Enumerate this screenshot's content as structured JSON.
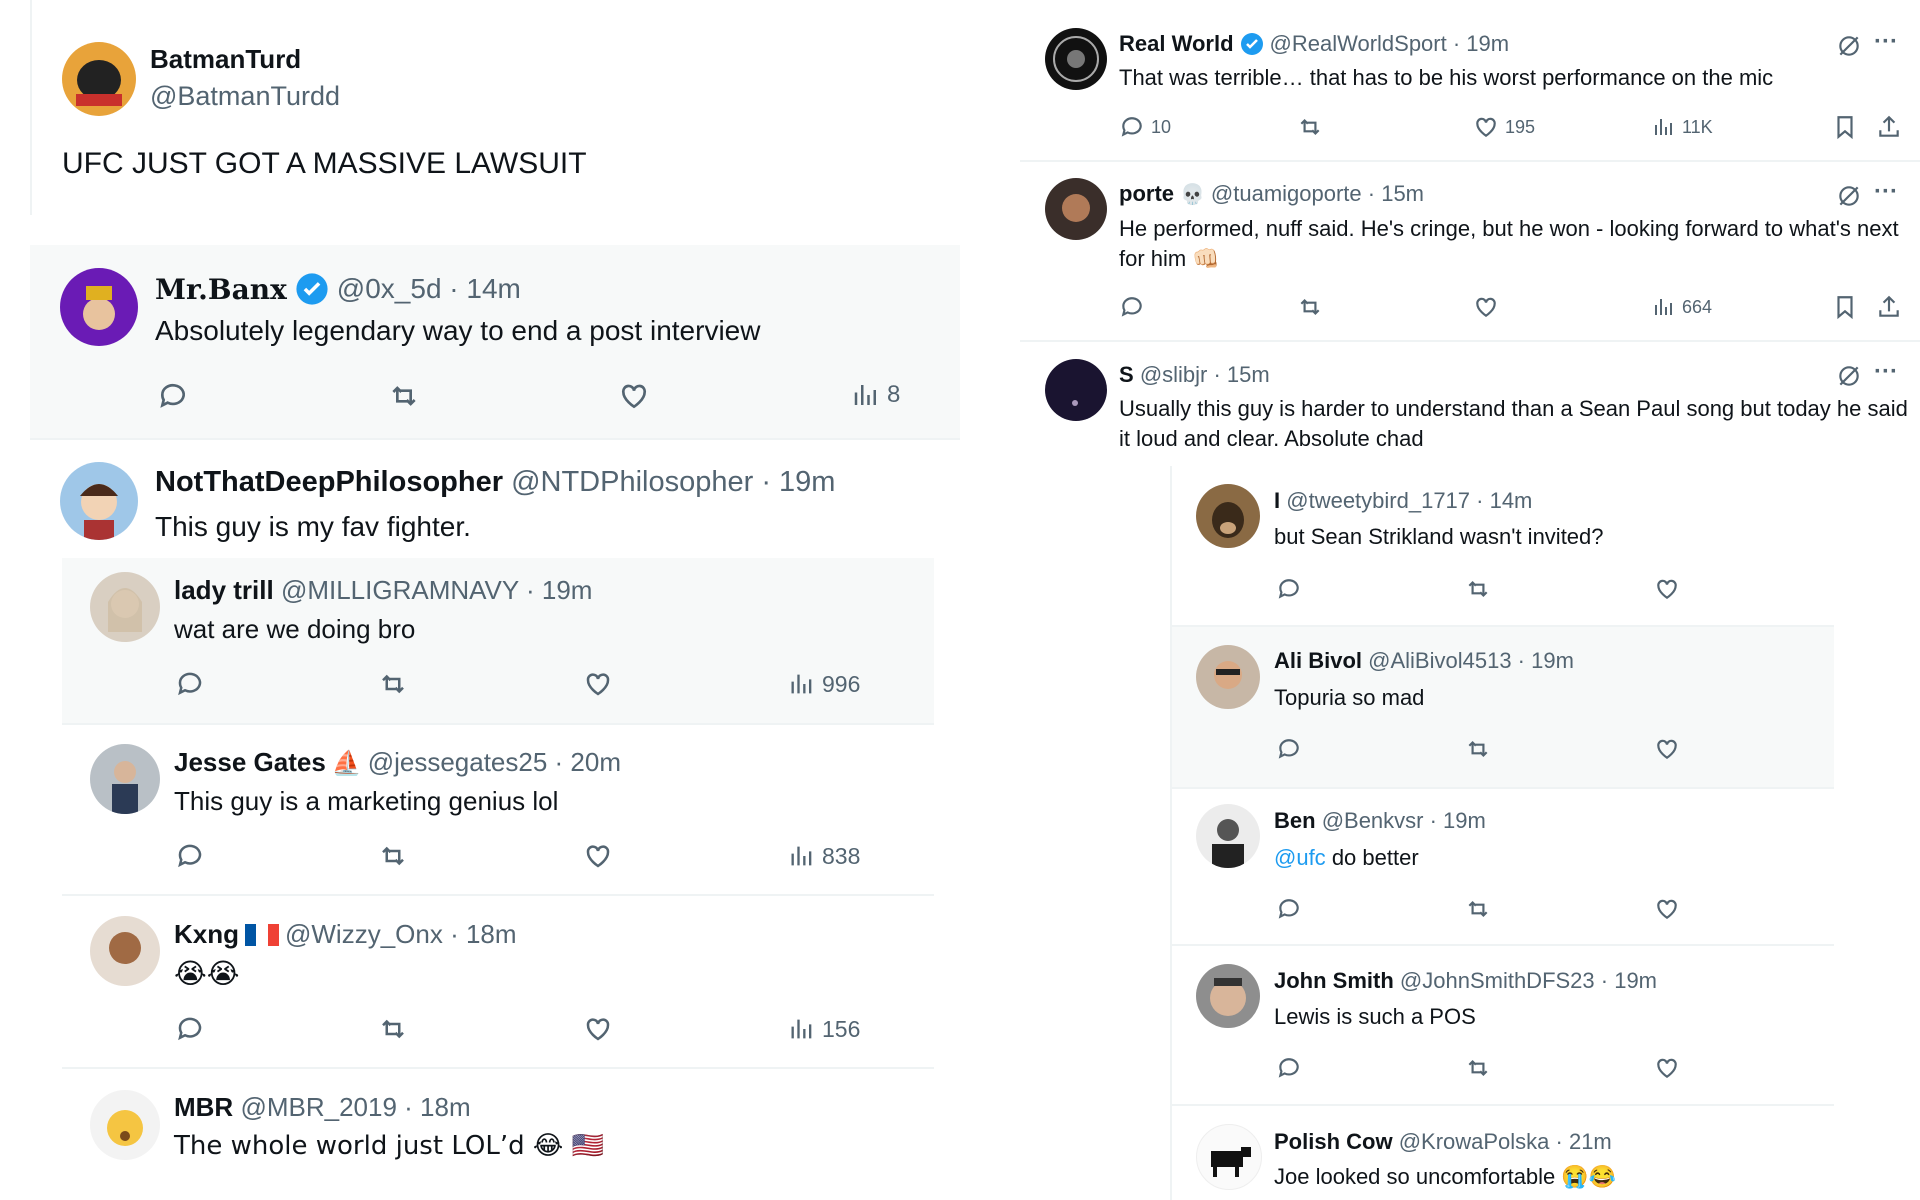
{
  "colors": {
    "text": "#0f1419",
    "muted": "#536471",
    "link": "#1d9bf0",
    "verified": "#1d9bf0",
    "border": "#eff3f4",
    "tint": "#f7f9f9"
  },
  "left": {
    "main": {
      "name": "BatmanTurd",
      "handle": "@BatmanTurdd",
      "text": "UFC JUST GOT A MASSIVE LAWSUIT"
    },
    "t1": {
      "name": "Mr.Banx",
      "handle": "@0x_5d · 14m",
      "text": "Absolutely legendary way to end a post interview",
      "views": "8"
    },
    "t2": {
      "name": "NotThatDeepPhilosopher",
      "handle": "@NTDPhilosopher · 19m",
      "text": "This guy is my fav fighter."
    },
    "r1": {
      "name": "lady trill",
      "handle": "@MILLIGRAMNAVY · 19m",
      "text": "wat are we doing bro",
      "views": "996"
    },
    "r2": {
      "name": "Jesse Gates",
      "handle": "@jessegates25 · 20m",
      "text": "This guy is a marketing genius lol",
      "views": "838"
    },
    "r3": {
      "name": "Kxng",
      "handle": "@Wizzy_Onx · 18m",
      "text": "😭😭",
      "views": "156"
    },
    "r4": {
      "name": "MBR",
      "handle": "@MBR_2019 · 18m",
      "text": "The whole world just LOL’d 😂 🇺🇸"
    }
  },
  "right": {
    "t1": {
      "name": "Real World",
      "handle": "@RealWorldSport · 19m",
      "text": "That was terrible… that has to be his worst performance on the mic",
      "replies": "10",
      "likes": "195",
      "views": "11K"
    },
    "t2": {
      "name": "porte",
      "handle": "@tuamigoporte · 15m",
      "text": "He performed, nuff said. He's cringe, but he won - looking forward to what's next for him 👊🏻",
      "views": "664"
    },
    "t3": {
      "name": "S",
      "handle": "@slibjr · 15m",
      "text": "Usually this guy is harder to understand than a Sean Paul song but today he said it loud and clear. Absolute chad"
    },
    "n1": {
      "name": "I",
      "handle": "@tweetybird_1717 · 14m",
      "text": "but Sean Strikland wasn't invited?"
    },
    "n2": {
      "name": "Ali Bivol",
      "handle": "@AliBivol4513 · 19m",
      "text": "Topuria so mad"
    },
    "n3": {
      "name": "Ben",
      "handle": "@Benkvsr · 19m",
      "mention": "@ufc",
      "text": "do better"
    },
    "n4": {
      "name": "John Smith",
      "handle": "@JohnSmithDFS23 · 19m",
      "text": "Lewis is such a POS"
    },
    "n5": {
      "name": "Polish Cow",
      "handle": "@KrowaPolska · 21m",
      "text": "Joe looked so uncomfortable 😭😂"
    }
  }
}
